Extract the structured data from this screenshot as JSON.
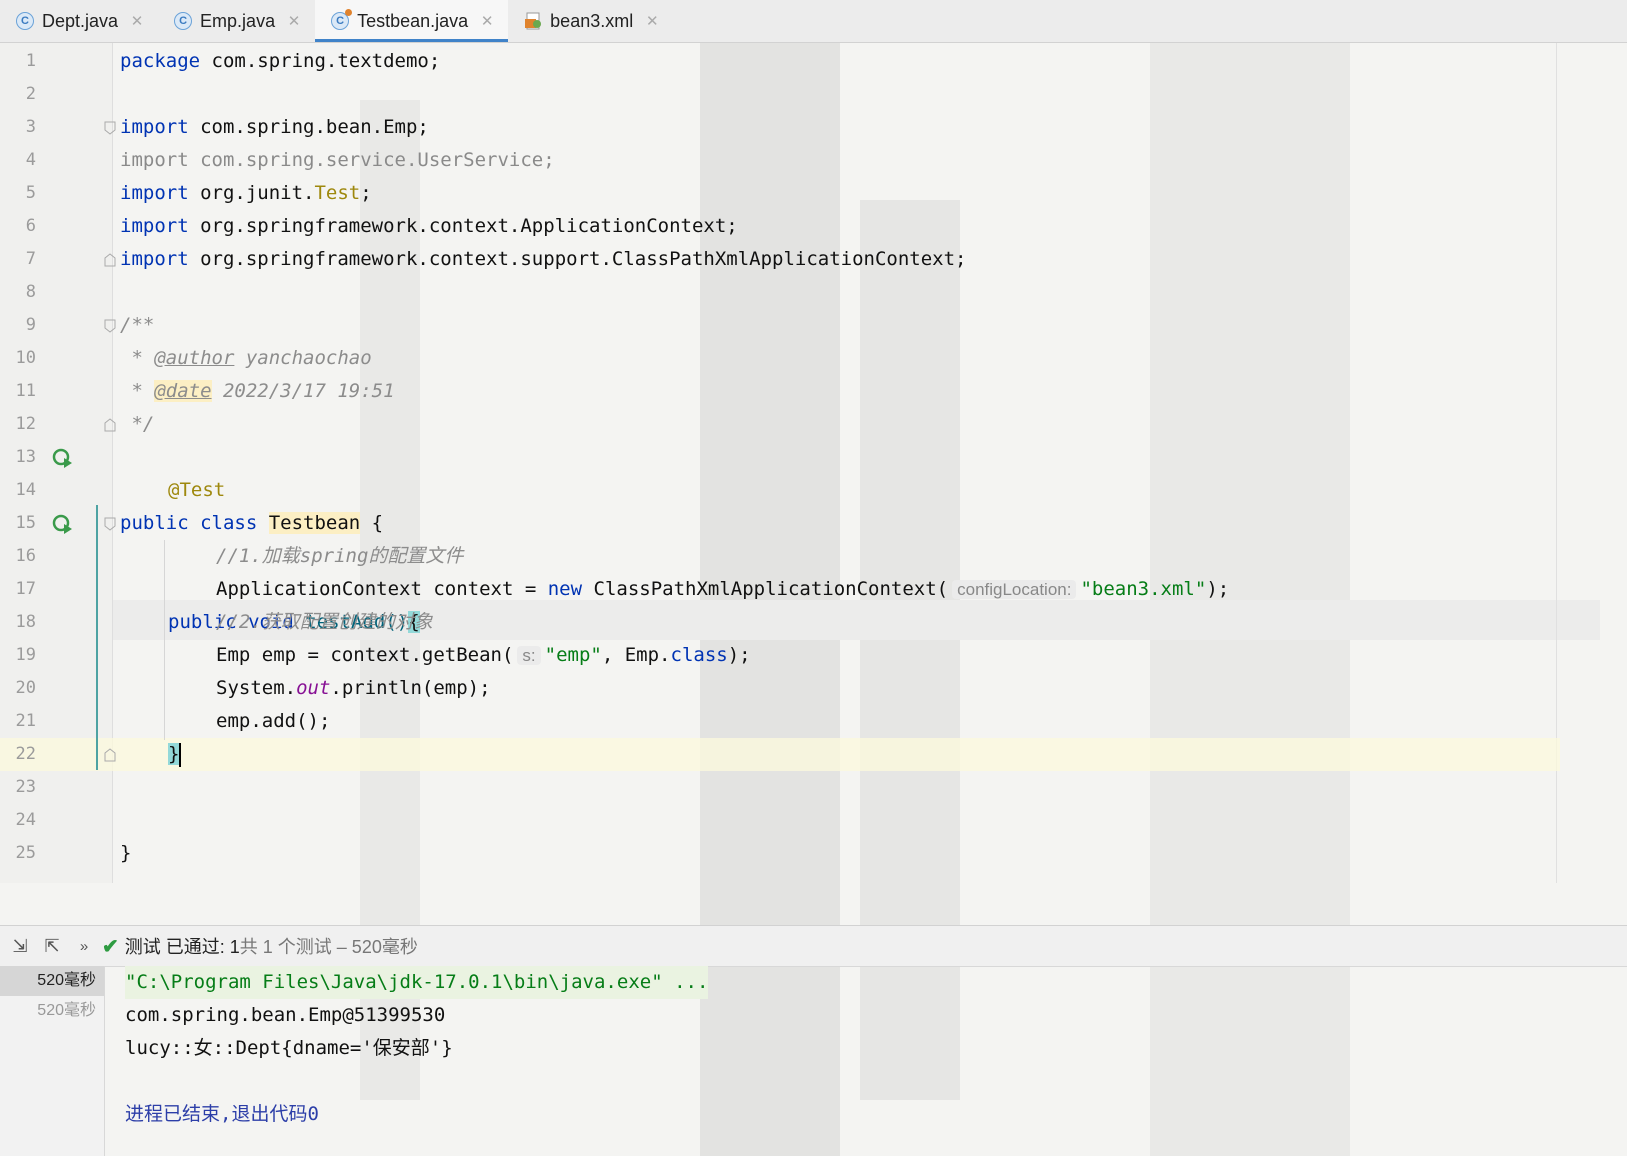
{
  "tabs": [
    {
      "label": "Dept.java",
      "icon": "java-class-icon",
      "active": false
    },
    {
      "label": "Emp.java",
      "icon": "java-class-icon",
      "active": false
    },
    {
      "label": "Testbean.java",
      "icon": "java-test-class-icon",
      "active": true
    },
    {
      "label": "bean3.xml",
      "icon": "xml-file-icon",
      "active": false
    }
  ],
  "editor": {
    "line_numbers": [
      "1",
      "2",
      "3",
      "4",
      "5",
      "6",
      "7",
      "8",
      "9",
      "10",
      "11",
      "12",
      "13",
      "14",
      "15",
      "16",
      "17",
      "18",
      "19",
      "20",
      "21",
      "22",
      "23",
      "24",
      "25"
    ],
    "code": {
      "l1_kw": "package",
      "l1_rest": " com.spring.textdemo;",
      "l3_kw": "import",
      "l3_rest": " com.spring.bean.Emp;",
      "l4_text": "import com.spring.service.UserService;",
      "l5_kw": "import",
      "l5_rest": " org.junit.",
      "l5_ann": "Test",
      "l5_end": ";",
      "l6_kw": "import",
      "l6_rest": " org.springframework.context.ApplicationContext;",
      "l7_kw": "import",
      "l7_rest": " org.springframework.context.support.ClassPathXmlApplicationContext;",
      "l9": "/**",
      "l10_a": " * ",
      "l10_tag": "@author",
      "l10_b": " yanchaochao",
      "l11_a": " * ",
      "l11_tag": "@date",
      "l11_b": " 2022/3/17 19:51",
      "l12": " */",
      "l13_kw": "public class ",
      "l13_cls": "Testbean",
      "l13_end": " {",
      "l14": "@Test",
      "l15_kw": "public void ",
      "l15_name": "testAdd()",
      "l15_brace": "{",
      "l16": "//1.加载spring的配置文件",
      "l17_a": "ApplicationContext context = ",
      "l17_kw": "new",
      "l17_b": " ClassPathXmlApplicationContext(",
      "l17_hint": "configLocation:",
      "l17_str": "\"bean3.xml\"",
      "l17_end": ");",
      "l18": "//2.获取配置创建的对象",
      "l19_a": "Emp emp = context.getBean(",
      "l19_hint": "s:",
      "l19_str": "\"emp\"",
      "l19_b": ", Emp.",
      "l19_kw": "class",
      "l19_end": ");",
      "l20_a": "System.",
      "l20_fld": "out",
      "l20_b": ".println(emp);",
      "l21": "emp.add();",
      "l22": "}",
      "l25": "}"
    }
  },
  "test_bar": {
    "status_main": "测试 已通过: 1",
    "status_sub": "共 1 个测试 – 520毫秒"
  },
  "test_tree": [
    {
      "label": "520毫秒",
      "selected": true
    },
    {
      "label": "520毫秒",
      "selected": false
    }
  ],
  "console": {
    "cmd": "\"C:\\Program Files\\Java\\jdk-17.0.1\\bin\\java.exe\" ...",
    "line1": "com.spring.bean.Emp@51399530",
    "line2": "lucy::女::Dept{dname='保安部'}",
    "exit": "进程已结束,退出代码0"
  },
  "colors": {
    "accent": "#4083c9",
    "keyword": "#0033b3",
    "string": "#067d17",
    "pass": "#2e9b41"
  }
}
